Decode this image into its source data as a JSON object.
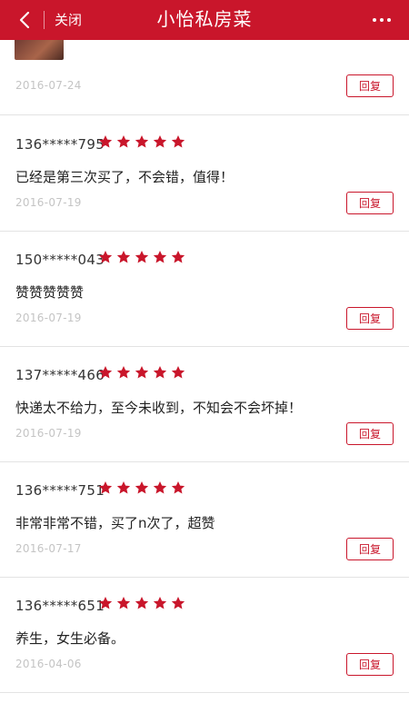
{
  "header": {
    "close_label": "关闭",
    "title": "小怡私房菜"
  },
  "colors": {
    "brand": "#c9162b",
    "star": "#c9162b",
    "date": "#c4c4c4"
  },
  "first_review": {
    "date": "2016-07-24",
    "reply_label": "回复"
  },
  "reviews": [
    {
      "user": "136*****795",
      "rating": 5,
      "text": "已经是第三次买了，不会错，值得！",
      "date": "2016-07-19",
      "reply_label": "回复"
    },
    {
      "user": "150*****043",
      "rating": 5,
      "text": "赞赞赞赞赞",
      "date": "2016-07-19",
      "reply_label": "回复"
    },
    {
      "user": "137*****466",
      "rating": 5,
      "text": "快递太不给力，至今未收到，不知会不会坏掉！",
      "date": "2016-07-19",
      "reply_label": "回复"
    },
    {
      "user": "136*****751",
      "rating": 5,
      "text": "非常非常不错，买了n次了，超赞",
      "date": "2016-07-17",
      "reply_label": "回复"
    },
    {
      "user": "136*****651",
      "rating": 5,
      "text": "养生，女生必备。",
      "date": "2016-04-06",
      "reply_label": "回复"
    }
  ]
}
